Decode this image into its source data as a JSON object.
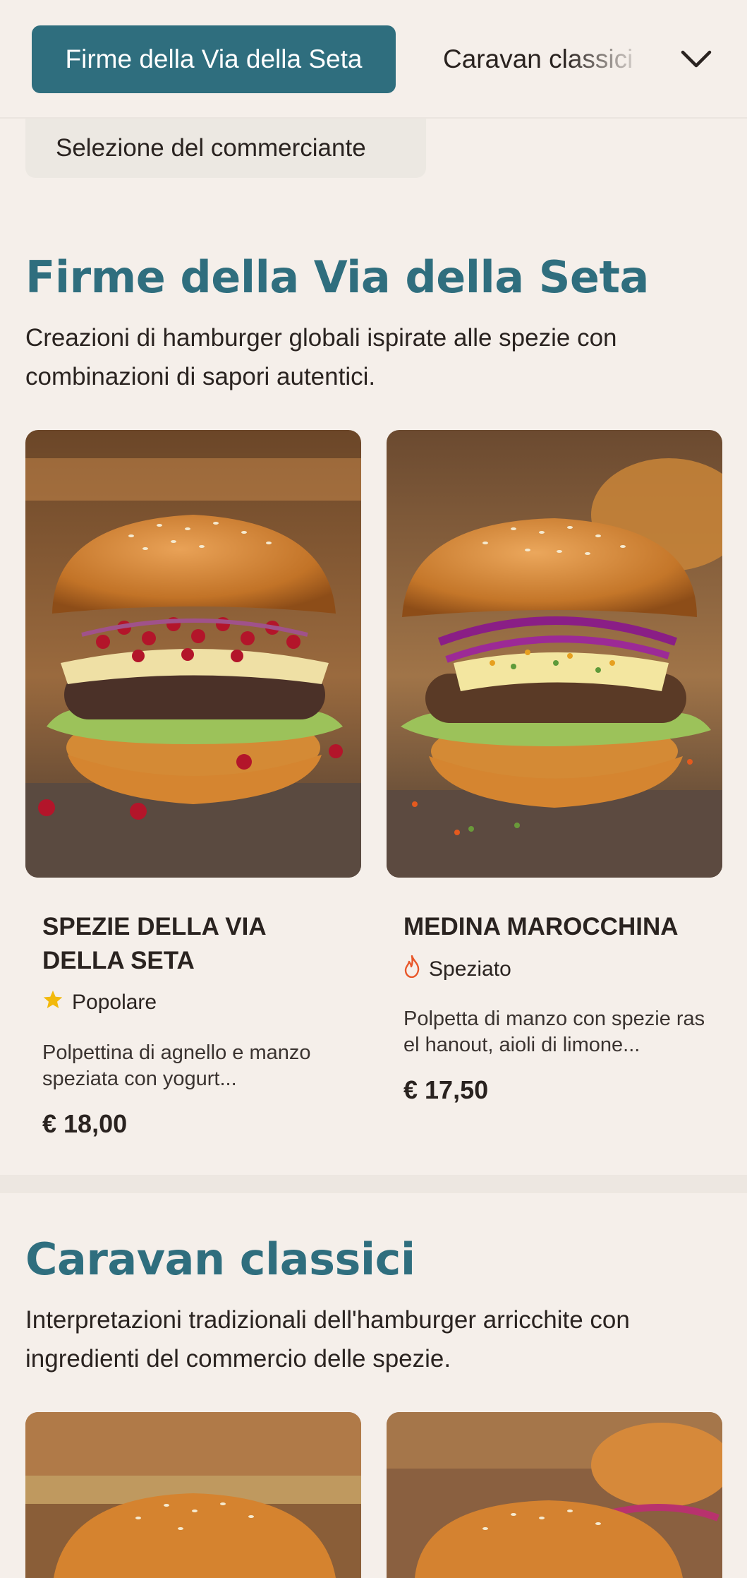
{
  "nav": {
    "active_tab": "Firme della Via della Seta",
    "next_tab": "Caravan classici",
    "sub_tab": "Selezione del commerciante"
  },
  "sections": [
    {
      "title": "Firme della Via della Seta",
      "description": "Creazioni di hamburger globali ispirate alle spezie con combinazioni di sapori autentici.",
      "items": [
        {
          "name": "SPEZIE DELLA VIA DELLA SETA",
          "tag": "Popolare",
          "tag_icon": "star-icon",
          "description": "Polpettina di agnello e manzo speziata con yogurt...",
          "price": "€ 18,00"
        },
        {
          "name": "MEDINA MAROCCHINA",
          "tag": "Speziato",
          "tag_icon": "flame-icon",
          "description": "Polpetta di manzo con spezie ras el hanout, aioli di limone...",
          "price": "€ 17,50"
        }
      ]
    },
    {
      "title": "Caravan classici",
      "description": "Interpretazioni tradizionali dell'hamburger arricchite con ingredienti del commercio delle spezie."
    }
  ],
  "colors": {
    "accent": "#2f6e7e",
    "background": "#f5efea",
    "star": "#f2b90c",
    "flame": "#e8572a"
  }
}
